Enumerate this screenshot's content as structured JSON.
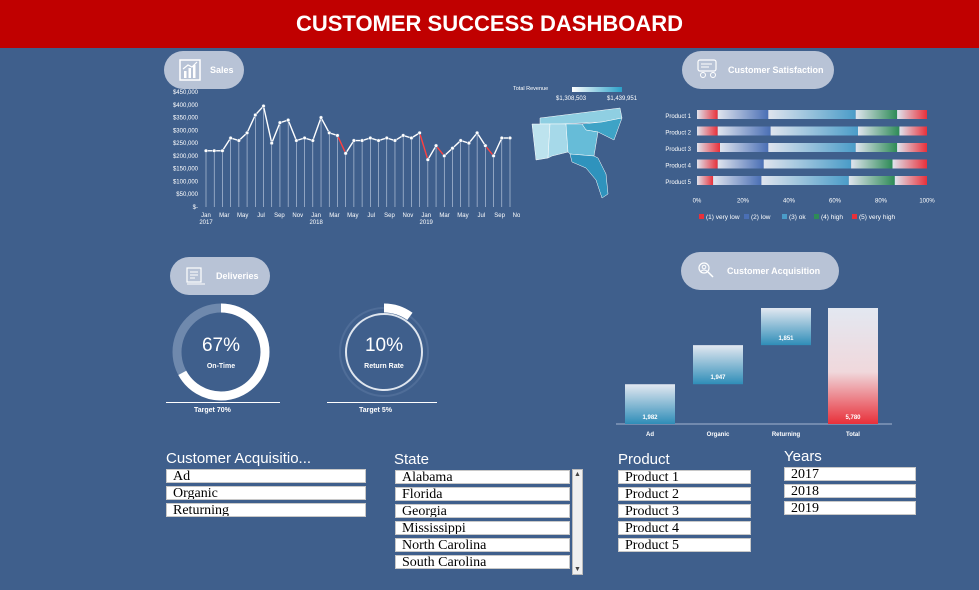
{
  "header": {
    "title": "CUSTOMER SUCCESS DASHBOARD"
  },
  "sections": {
    "sales": "Sales",
    "deliveries": "Deliveries",
    "satisfaction": "Customer Satisfaction",
    "acquisition": "Customer Acquisition"
  },
  "sales_chart": {
    "type": "line",
    "y_ticks": [
      "$450,000",
      "$400,000",
      "$350,000",
      "$300,000",
      "$250,000",
      "$200,000",
      "$150,000",
      "$100,000",
      "$50,000",
      "$-"
    ],
    "ylim": [
      0,
      450000
    ],
    "values": [
      220000,
      220000,
      220000,
      270000,
      260000,
      290000,
      360000,
      395000,
      250000,
      330000,
      340000,
      260000,
      270000,
      260000,
      350000,
      290000,
      280000,
      210000,
      260000,
      260000,
      270000,
      260000,
      270000,
      260000,
      280000,
      270000,
      290000,
      185000,
      240000,
      200000,
      230000,
      260000,
      250000,
      290000,
      240000,
      200000,
      270000,
      270000
    ],
    "x_tick_labels": [
      "Jan",
      "Mar",
      "May",
      "Jul",
      "Sep",
      "Nov",
      "Jan",
      "Mar",
      "May",
      "Jul",
      "Sep",
      "Nov",
      "Jan",
      "Mar",
      "May",
      "Jul",
      "Sep",
      "Nov"
    ],
    "year_labels": [
      "2017",
      "2018",
      "2019"
    ],
    "line_color": "#ffffff",
    "dip_color": "#ff4040"
  },
  "map": {
    "legend_title": "Total Revenue",
    "min_label": "$1,308,503",
    "max_label": "$1,439,951"
  },
  "satisfaction": {
    "type": "bar",
    "categories": [
      "Product 1",
      "Product 2",
      "Product 3",
      "Product 4",
      "Product 5"
    ],
    "x_ticks": [
      "0%",
      "20%",
      "40%",
      "60%",
      "80%",
      "100%"
    ],
    "legend": [
      "(1) very low",
      "(2) low",
      "(3) ok",
      "(4) high",
      "(5) very high"
    ],
    "colors": [
      "#e8303a",
      "#4a6fb5",
      "#4a9cc8",
      "#2e8b57",
      "#e8303a"
    ],
    "series": [
      {
        "name": "(1) very low",
        "values": [
          9,
          9,
          10,
          9,
          7
        ]
      },
      {
        "name": "(2) low",
        "values": [
          22,
          23,
          21,
          20,
          21
        ]
      },
      {
        "name": "(3) ok",
        "values": [
          38,
          38,
          38,
          38,
          38
        ]
      },
      {
        "name": "(4) high",
        "values": [
          18,
          18,
          18,
          18,
          20
        ]
      },
      {
        "name": "(5) very high",
        "values": [
          13,
          12,
          13,
          15,
          14
        ]
      }
    ]
  },
  "deliveries": {
    "on_time": {
      "value": "67%",
      "label": "On-Time",
      "fraction": 0.67,
      "target": "Target 70%"
    },
    "return_rate": {
      "value": "10%",
      "label": "Return Rate",
      "fraction": 0.1,
      "target": "Target 5%"
    }
  },
  "acquisition_chart": {
    "type": "bar",
    "categories": [
      "Ad",
      "Organic",
      "Returning",
      "Total"
    ],
    "starts": [
      0,
      1982,
      3929,
      0
    ],
    "values": [
      1982,
      1947,
      1851,
      5780
    ],
    "labels": [
      "1,982",
      "1,947",
      "1,851",
      "5,780"
    ],
    "total_color": "#e8303a"
  },
  "slicers": {
    "acquisition": {
      "title": "Customer Acquisitio...",
      "items": [
        "Ad",
        "Organic",
        "Returning"
      ]
    },
    "state": {
      "title": "State",
      "items": [
        "Alabama",
        "Florida",
        "Georgia",
        "Mississippi",
        "North Carolina",
        "South Carolina"
      ]
    },
    "product": {
      "title": "Product",
      "items": [
        "Product 1",
        "Product 2",
        "Product 3",
        "Product 4",
        "Product 5"
      ]
    },
    "years": {
      "title": "Years",
      "items": [
        "2017",
        "2018",
        "2019"
      ]
    }
  }
}
